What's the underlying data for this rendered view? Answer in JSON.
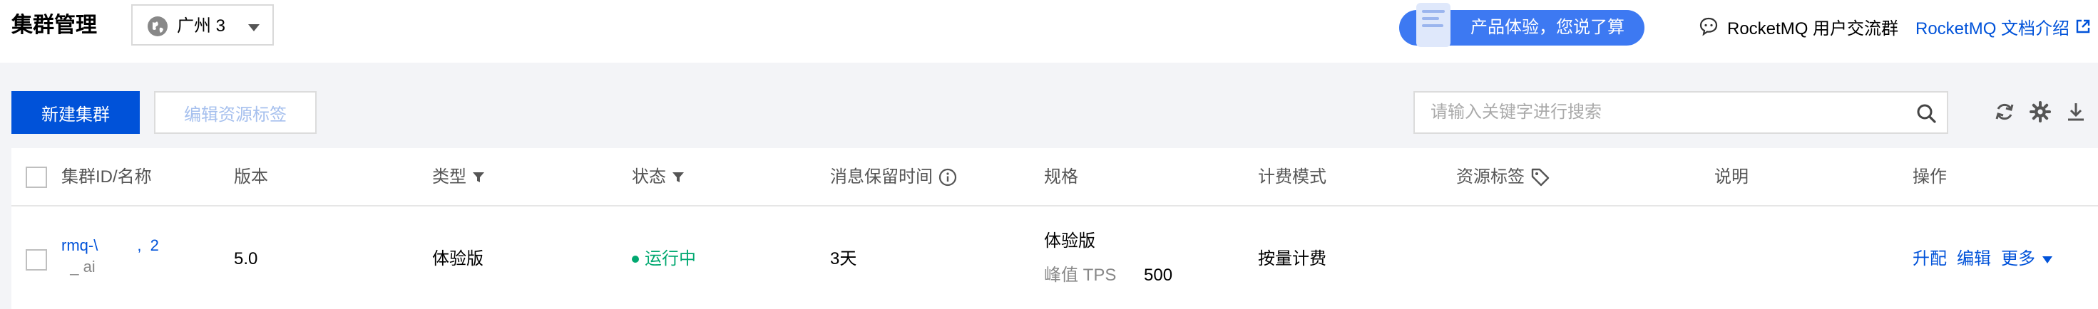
{
  "header": {
    "title": "集群管理",
    "region": "广州 3",
    "feedback_label": "产品体验，您说了算",
    "community_label": "RocketMQ 用户交流群",
    "docs_label": "RocketMQ 文档介绍"
  },
  "toolbar": {
    "create_label": "新建集群",
    "edit_tags_label": "编辑资源标签",
    "search_placeholder": "请输入关键字进行搜索",
    "icons": [
      "search-icon",
      "refresh-icon",
      "settings-icon",
      "download-icon"
    ]
  },
  "table": {
    "columns": [
      "集群ID/名称",
      "版本",
      "类型",
      "状态",
      "消息保留时间",
      "规格",
      "计费模式",
      "资源标签",
      "说明",
      "操作"
    ],
    "rows": [
      {
        "id": "rmq-\\         ,  2",
        "name": "  _ ai",
        "version": "5.0",
        "type": "体验版",
        "status": "运行中",
        "retention": "3天",
        "spec_name": "体验版",
        "spec_tps_label": "峰值 TPS",
        "spec_tps_value": "500",
        "billing": "按量计费",
        "tags": "",
        "description": "",
        "actions": [
          "升配",
          "编辑",
          "更多"
        ]
      }
    ]
  },
  "colors": {
    "primary": "#0052d9",
    "success": "#00a870",
    "page_bg": "#f3f4f7"
  }
}
